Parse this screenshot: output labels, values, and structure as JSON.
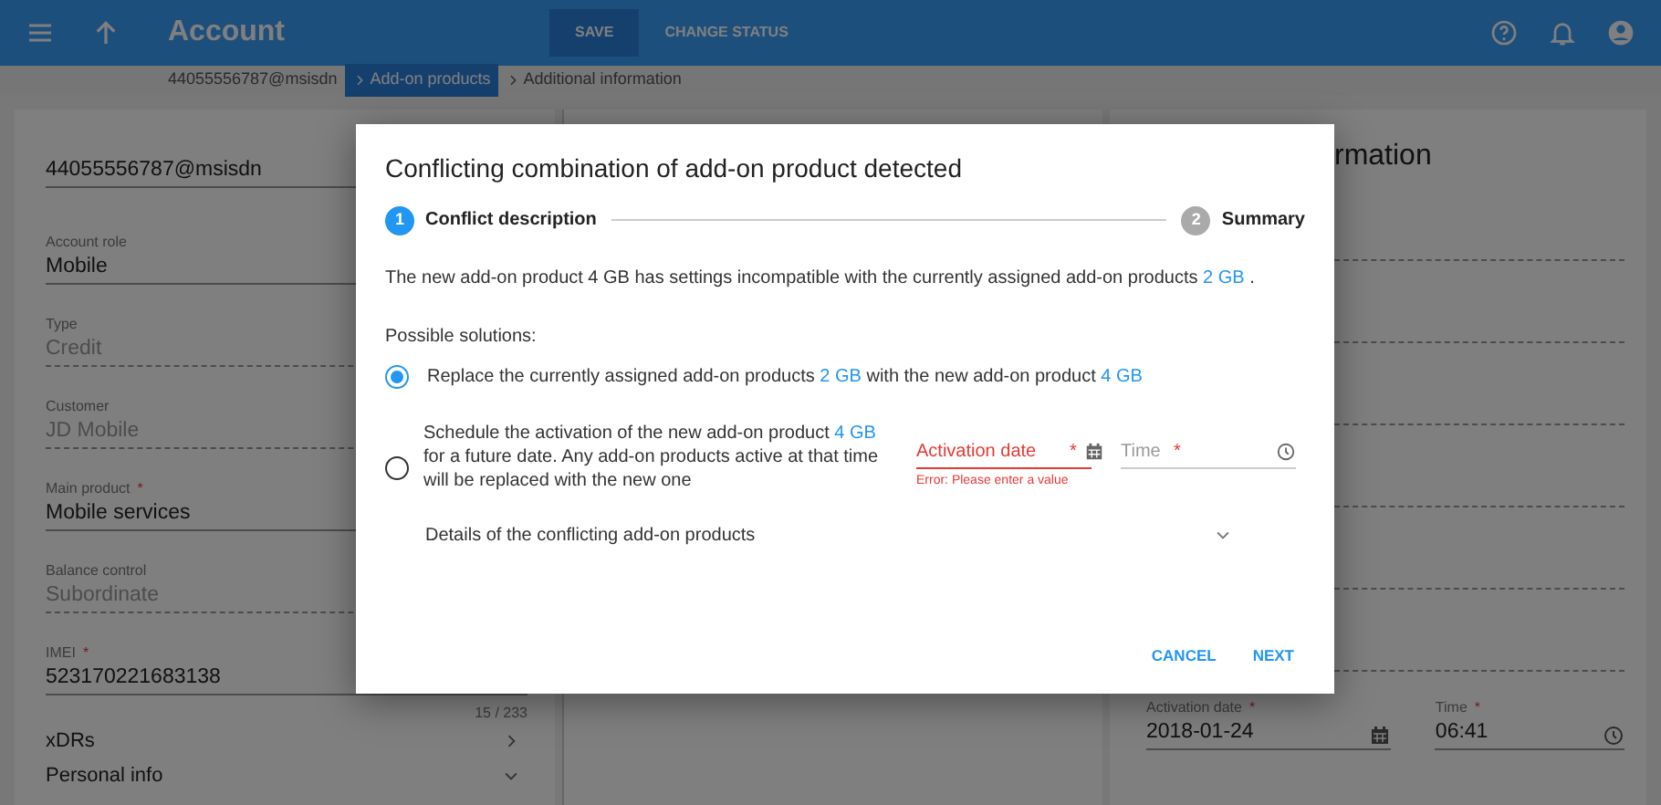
{
  "app_bar": {
    "title": "Account",
    "actions": [
      {
        "label": "SAVE",
        "selected": true
      },
      {
        "label": "CHANGE STATUS",
        "selected": false
      }
    ]
  },
  "breadcrumb": [
    {
      "label": "44055556787@msisdn",
      "selected": false
    },
    {
      "label": "Add-on products",
      "selected": true
    },
    {
      "label": "Additional information",
      "selected": false
    }
  ],
  "left_panel": {
    "fields": [
      {
        "value": "44055556787@msisdn",
        "disabled": false
      },
      {
        "label": "Account role",
        "value": "Mobile",
        "disabled": false
      },
      {
        "label": "Type",
        "value": "Credit",
        "disabled": true
      },
      {
        "label": "Customer",
        "value": "JD Mobile",
        "disabled": true
      },
      {
        "label": "Main product",
        "required_mark": "*",
        "value": "Mobile services",
        "disabled": false
      },
      {
        "label": "Balance control",
        "value": "Subordinate",
        "disabled": true
      },
      {
        "label": "IMEI",
        "required_mark": "*",
        "value": "523170221683138",
        "disabled": false,
        "counter": "15 / 233"
      }
    ],
    "sections": [
      {
        "label": "xDRs",
        "expanded": false
      },
      {
        "label": "Personal info",
        "expanded": true
      }
    ]
  },
  "right_panel": {
    "title": "rmation",
    "fields": [
      {
        "label": "Activation date",
        "required_mark": "*",
        "value": "2018-01-24",
        "kind": "date"
      },
      {
        "label": "Time",
        "required_mark": "*",
        "value": "06:41",
        "kind": "time"
      }
    ]
  },
  "dialog": {
    "title": "Conflicting combination of add-on product detected",
    "steps": [
      {
        "number": "1",
        "label": "Conflict description",
        "selected": true
      },
      {
        "number": "2",
        "label": "Summary",
        "selected": false
      }
    ],
    "description": [
      {
        "kind": "text",
        "text": "The new add-on product 4 GB has settings incompatible with the currently assigned add-on products "
      },
      {
        "kind": "link",
        "text": "2 GB"
      },
      {
        "kind": "text",
        "text": " ."
      }
    ],
    "solutions_label": "Possible solutions:",
    "options": [
      {
        "selected": true,
        "segments": [
          {
            "kind": "text",
            "text": "Replace the currently assigned add-on products "
          },
          {
            "kind": "link",
            "text": "2 GB"
          },
          {
            "kind": "text",
            "text": " with the new add-on product "
          },
          {
            "kind": "link",
            "text": "4 GB"
          }
        ]
      },
      {
        "selected": false,
        "segments": [
          {
            "kind": "text",
            "text": "Schedule the activation of the new add-on product "
          },
          {
            "kind": "link",
            "text": "4 GB"
          },
          {
            "kind": "text",
            "text": " for a future date. Any add-on products active at that time will be replaced with the new one"
          }
        ],
        "fields": [
          {
            "placeholder": "Activation date",
            "required_mark": "*",
            "kind": "date",
            "error": "Error: Please enter a value"
          },
          {
            "placeholder": "Time",
            "required_mark": "*",
            "kind": "time"
          }
        ]
      }
    ],
    "details": {
      "label": "Details of the conflicting add-on products",
      "expanded": false
    },
    "buttons": [
      "CANCEL",
      "NEXT"
    ]
  }
}
